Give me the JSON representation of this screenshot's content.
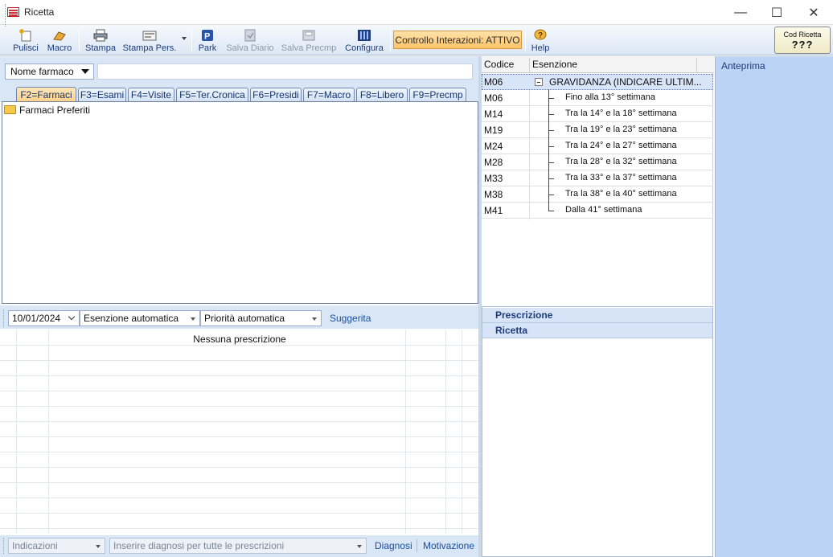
{
  "window": {
    "title": "Ricetta",
    "minimize": "—",
    "maximize": "☐",
    "close": "✕"
  },
  "toolbar": {
    "pulisci": "Pulisci",
    "macro": "Macro",
    "stampa": "Stampa",
    "stampa_pers": "Stampa Pers.",
    "park": "Park",
    "salva_diario": "Salva Diario",
    "salva_precmp": "Salva Precmp",
    "configura": "Configura",
    "controllo": "Controllo Interazioni: ATTIVO",
    "help": "Help",
    "cod_ricetta_label": "Cod Ricetta",
    "cod_ricetta_value": "???"
  },
  "search": {
    "mode": "Nome farmaco",
    "value": ""
  },
  "tabs": [
    "F2=Farmaci",
    "F3=Esami",
    "F4=Visite",
    "F5=Ter.Cronica",
    "F6=Presidi",
    "F7=Macro",
    "F8=Libero",
    "F9=Precmp"
  ],
  "tree": {
    "root": "Farmaci Preferiti"
  },
  "prescription_bar": {
    "date": "10/01/2024",
    "esenzione": "Esenzione automatica",
    "priorita": "Priorità automatica",
    "suggerita": "Suggerita"
  },
  "grid": {
    "empty_text": "Nessuna prescrizione"
  },
  "bottom_bar": {
    "indicazioni": "Indicazioni",
    "diagnosi_placeholder": "Inserire diagnosi per tutte le prescrizioni",
    "diagnosi": "Diagnosi",
    "motivazione": "Motivazione"
  },
  "exemptions": {
    "col_code": "Codice",
    "col_desc": "Esenzione",
    "rows": [
      {
        "code": "M06",
        "desc": "GRAVIDANZA (INDICARE ULTIM..."
      },
      {
        "code": "M06",
        "desc": "Fino alla 13° settimana"
      },
      {
        "code": "M14",
        "desc": "Tra la 14° e la 18° settimana"
      },
      {
        "code": "M19",
        "desc": "Tra la 19° e la 23° settimana"
      },
      {
        "code": "M24",
        "desc": "Tra la 24° e la 27° settimana"
      },
      {
        "code": "M28",
        "desc": "Tra la 28° e la 32° settimana"
      },
      {
        "code": "M33",
        "desc": "Tra la 33° e la 37° settimana"
      },
      {
        "code": "M38",
        "desc": "Tra la 38° e la 40° settimana"
      },
      {
        "code": "M41",
        "desc": "Dalla 41° settimana"
      }
    ]
  },
  "panels": {
    "prescrizione": "Prescrizione",
    "ricetta": "Ricetta",
    "anteprima": "Anteprima"
  },
  "colors": {
    "accent": "#ffc46a",
    "panel": "#d9e6f6",
    "preview": "#bcd3f5"
  }
}
